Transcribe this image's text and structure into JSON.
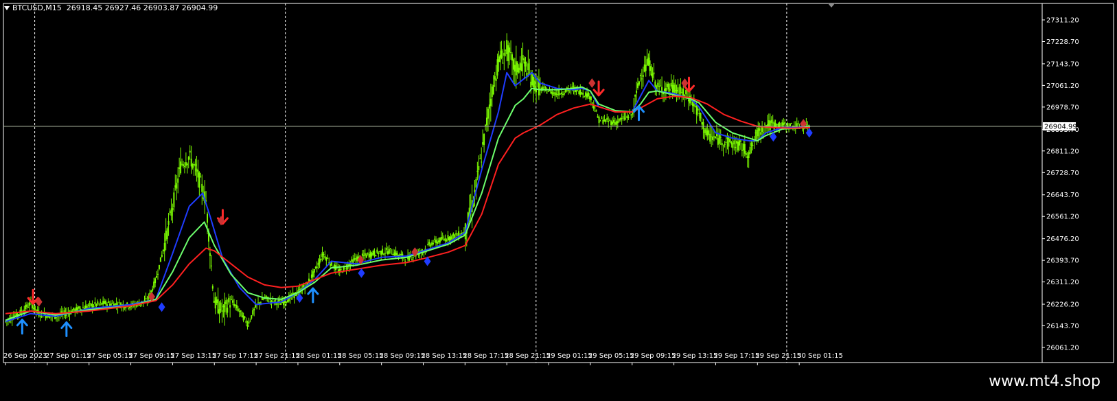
{
  "header": {
    "symbol": "BTCUSD,M15",
    "ohlc": "26918.45 26927.46 26903.87 26904.99"
  },
  "watermark": "www.mt4.shop",
  "colors": {
    "background": "#000000",
    "frame": "#ffffff",
    "candle": "#7CFC00",
    "ma_blue": "#1f3cff",
    "ma_green": "#6dff6d",
    "ma_red": "#ff2020",
    "arrow_up": "#1e90ff",
    "arrow_down": "#ff2a2a",
    "diamond_red": "#cc3333",
    "diamond_blue": "#1f3cff",
    "current_price_line": "#a9b29d"
  },
  "chart_data": {
    "type": "candlestick",
    "current_price": 26904.99,
    "current_price_label": "26904.99",
    "y_range": [
      26040,
      27340
    ],
    "x_range": [
      0,
      100
    ],
    "y_ticks": [
      {
        "value": 27311.2,
        "label": "27311.20"
      },
      {
        "value": 27228.7,
        "label": "27228.70"
      },
      {
        "value": 27143.7,
        "label": "27143.70"
      },
      {
        "value": 27061.2,
        "label": "27061.20"
      },
      {
        "value": 26978.7,
        "label": "26978.70"
      },
      {
        "value": 26893.7,
        "label": "26893.70"
      },
      {
        "value": 26811.2,
        "label": "26811.20"
      },
      {
        "value": 26728.7,
        "label": "26728.70"
      },
      {
        "value": 26643.7,
        "label": "26643.70"
      },
      {
        "value": 26561.2,
        "label": "26561.20"
      },
      {
        "value": 26476.2,
        "label": "26476.20"
      },
      {
        "value": 26393.7,
        "label": "26393.70"
      },
      {
        "value": 26311.2,
        "label": "26311.20"
      },
      {
        "value": 26226.2,
        "label": "26226.20"
      },
      {
        "value": 26143.7,
        "label": "26143.70"
      },
      {
        "value": 26061.2,
        "label": "26061.20"
      }
    ],
    "x_ticks": [
      {
        "x": 0,
        "label": "26 Sep 2023"
      },
      {
        "x": 5,
        "label": "27 Sep 01:15"
      },
      {
        "x": 10,
        "label": "27 Sep 05:15"
      },
      {
        "x": 15,
        "label": "27 Sep 09:15"
      },
      {
        "x": 20,
        "label": "27 Sep 13:15"
      },
      {
        "x": 25,
        "label": "27 Sep 17:15"
      },
      {
        "x": 30,
        "label": "27 Sep 21:15"
      },
      {
        "x": 35,
        "label": "28 Sep 01:15"
      },
      {
        "x": 40,
        "label": "28 Sep 05:15"
      },
      {
        "x": 45,
        "label": "28 Sep 09:15"
      },
      {
        "x": 50,
        "label": "28 Sep 13:15"
      },
      {
        "x": 55,
        "label": "28 Sep 17:15"
      },
      {
        "x": 60,
        "label": "28 Sep 21:15"
      },
      {
        "x": 65,
        "label": "29 Sep 01:15"
      },
      {
        "x": 70,
        "label": "29 Sep 05:15"
      },
      {
        "x": 75,
        "label": "29 Sep 09:15"
      },
      {
        "x": 80,
        "label": "29 Sep 13:15"
      },
      {
        "x": 85,
        "label": "29 Sep 17:15"
      },
      {
        "x": 90,
        "label": "29 Sep 21:15"
      },
      {
        "x": 95,
        "label": "30 Sep 01:15"
      }
    ],
    "day_separators": [
      3.5,
      33.5,
      63.5,
      93.5
    ],
    "price_anchors": [
      [
        0,
        26160
      ],
      [
        2,
        26200
      ],
      [
        3,
        26230
      ],
      [
        4,
        26190
      ],
      [
        6,
        26180
      ],
      [
        8,
        26200
      ],
      [
        10,
        26220
      ],
      [
        12,
        26230
      ],
      [
        15,
        26220
      ],
      [
        17,
        26240
      ],
      [
        18,
        26320
      ],
      [
        19,
        26450
      ],
      [
        20,
        26600
      ],
      [
        21,
        26760
      ],
      [
        22,
        26790
      ],
      [
        23,
        26720
      ],
      [
        24,
        26620
      ],
      [
        25,
        26230
      ],
      [
        26,
        26200
      ],
      [
        27,
        26240
      ],
      [
        28,
        26200
      ],
      [
        29,
        26150
      ],
      [
        30,
        26220
      ],
      [
        31,
        26250
      ],
      [
        32,
        26240
      ],
      [
        33,
        26230
      ],
      [
        34,
        26250
      ],
      [
        35,
        26270
      ],
      [
        36,
        26300
      ],
      [
        37,
        26350
      ],
      [
        38,
        26420
      ],
      [
        39,
        26380
      ],
      [
        40,
        26350
      ],
      [
        42,
        26400
      ],
      [
        44,
        26420
      ],
      [
        46,
        26430
      ],
      [
        48,
        26400
      ],
      [
        50,
        26430
      ],
      [
        51,
        26460
      ],
      [
        53,
        26480
      ],
      [
        55,
        26500
      ],
      [
        56,
        26620
      ],
      [
        57,
        26800
      ],
      [
        58,
        27000
      ],
      [
        59,
        27150
      ],
      [
        60,
        27200
      ],
      [
        61,
        27120
      ],
      [
        62,
        27150
      ],
      [
        63,
        27080
      ],
      [
        64,
        27050
      ],
      [
        66,
        27030
      ],
      [
        68,
        27050
      ],
      [
        70,
        27020
      ],
      [
        71,
        26930
      ],
      [
        73,
        26920
      ],
      [
        75,
        26950
      ],
      [
        76,
        27100
      ],
      [
        77,
        27150
      ],
      [
        78,
        27050
      ],
      [
        80,
        27050
      ],
      [
        82,
        27010
      ],
      [
        83,
        26950
      ],
      [
        84,
        26870
      ],
      [
        86,
        26850
      ],
      [
        88,
        26830
      ],
      [
        89,
        26800
      ],
      [
        90,
        26880
      ],
      [
        91,
        26910
      ],
      [
        93,
        26910
      ],
      [
        95,
        26905
      ],
      [
        96.3,
        26905
      ]
    ],
    "series": [
      {
        "name": "",
        "color_key": "ma_blue",
        "values": [
          [
            0,
            26160
          ],
          [
            3,
            26190
          ],
          [
            6,
            26180
          ],
          [
            10,
            26210
          ],
          [
            15,
            26225
          ],
          [
            18,
            26245
          ],
          [
            20,
            26420
          ],
          [
            22,
            26600
          ],
          [
            23.6,
            26650
          ],
          [
            24.5,
            26560
          ],
          [
            26,
            26400
          ],
          [
            28,
            26290
          ],
          [
            30,
            26225
          ],
          [
            33,
            26235
          ],
          [
            35,
            26270
          ],
          [
            37,
            26320
          ],
          [
            39,
            26390
          ],
          [
            42,
            26380
          ],
          [
            45,
            26405
          ],
          [
            48,
            26410
          ],
          [
            50,
            26430
          ],
          [
            53,
            26460
          ],
          [
            55,
            26500
          ],
          [
            57,
            26740
          ],
          [
            59,
            26960
          ],
          [
            60,
            27110
          ],
          [
            61,
            27060
          ],
          [
            62,
            27085
          ],
          [
            63,
            27110
          ],
          [
            64,
            27070
          ],
          [
            66,
            27050
          ],
          [
            68,
            27045
          ],
          [
            69,
            27050
          ],
          [
            70,
            27040
          ],
          [
            71,
            26980
          ],
          [
            73,
            26960
          ],
          [
            75,
            26960
          ],
          [
            76,
            27020
          ],
          [
            77,
            27080
          ],
          [
            78,
            27040
          ],
          [
            80,
            27030
          ],
          [
            82,
            27010
          ],
          [
            83,
            26980
          ],
          [
            85,
            26880
          ],
          [
            87,
            26860
          ],
          [
            89,
            26850
          ],
          [
            90,
            26850
          ],
          [
            91,
            26880
          ],
          [
            93,
            26900
          ],
          [
            95,
            26900
          ],
          [
            96.3,
            26905
          ]
        ]
      },
      {
        "name": "",
        "color_key": "ma_green",
        "values": [
          [
            0,
            26165
          ],
          [
            3,
            26200
          ],
          [
            6,
            26185
          ],
          [
            10,
            26205
          ],
          [
            15,
            26220
          ],
          [
            18,
            26245
          ],
          [
            20,
            26350
          ],
          [
            22,
            26480
          ],
          [
            23.8,
            26540
          ],
          [
            25,
            26450
          ],
          [
            27,
            26340
          ],
          [
            29,
            26270
          ],
          [
            31,
            26250
          ],
          [
            33,
            26245
          ],
          [
            35,
            26270
          ],
          [
            37,
            26310
          ],
          [
            39,
            26365
          ],
          [
            42,
            26375
          ],
          [
            45,
            26395
          ],
          [
            48,
            26405
          ],
          [
            50,
            26425
          ],
          [
            53,
            26455
          ],
          [
            55,
            26490
          ],
          [
            57,
            26650
          ],
          [
            59,
            26860
          ],
          [
            61,
            26985
          ],
          [
            62,
            27010
          ],
          [
            63,
            27050
          ],
          [
            64,
            27045
          ],
          [
            66,
            27045
          ],
          [
            68,
            27050
          ],
          [
            69,
            27055
          ],
          [
            70,
            27040
          ],
          [
            71,
            26990
          ],
          [
            73,
            26965
          ],
          [
            75,
            26960
          ],
          [
            76,
            26990
          ],
          [
            77,
            27035
          ],
          [
            78,
            27040
          ],
          [
            80,
            27025
          ],
          [
            82,
            27010
          ],
          [
            83,
            26995
          ],
          [
            85,
            26920
          ],
          [
            87,
            26880
          ],
          [
            89,
            26860
          ],
          [
            90,
            26850
          ],
          [
            91,
            26870
          ],
          [
            93,
            26895
          ],
          [
            95,
            26898
          ],
          [
            96.3,
            26905
          ]
        ]
      },
      {
        "name": "",
        "color_key": "ma_red",
        "values": [
          [
            0,
            26190
          ],
          [
            3,
            26200
          ],
          [
            6,
            26190
          ],
          [
            10,
            26200
          ],
          [
            15,
            26220
          ],
          [
            18,
            26240
          ],
          [
            20,
            26300
          ],
          [
            22,
            26380
          ],
          [
            24,
            26440
          ],
          [
            25,
            26430
          ],
          [
            27,
            26380
          ],
          [
            29,
            26330
          ],
          [
            31,
            26300
          ],
          [
            33,
            26290
          ],
          [
            35,
            26295
          ],
          [
            37,
            26320
          ],
          [
            39,
            26345
          ],
          [
            42,
            26360
          ],
          [
            45,
            26375
          ],
          [
            48,
            26385
          ],
          [
            50,
            26400
          ],
          [
            53,
            26425
          ],
          [
            55,
            26450
          ],
          [
            57,
            26570
          ],
          [
            59,
            26760
          ],
          [
            61,
            26860
          ],
          [
            62,
            26880
          ],
          [
            64,
            26910
          ],
          [
            66,
            26950
          ],
          [
            68,
            26975
          ],
          [
            70,
            26990
          ],
          [
            71,
            26980
          ],
          [
            73,
            26960
          ],
          [
            75,
            26960
          ],
          [
            76,
            26975
          ],
          [
            78,
            27010
          ],
          [
            80,
            27020
          ],
          [
            82,
            27015
          ],
          [
            84,
            26990
          ],
          [
            86,
            26950
          ],
          [
            88,
            26925
          ],
          [
            90,
            26905
          ],
          [
            92,
            26900
          ],
          [
            94,
            26898
          ],
          [
            96.3,
            26900
          ]
        ]
      }
    ],
    "markers": [
      {
        "type": "arrow-down",
        "x": 3.3,
        "y": 26265
      },
      {
        "type": "diamond-red",
        "x": 4.0,
        "y": 26235
      },
      {
        "type": "arrow-up",
        "x": 2.0,
        "y": 26130
      },
      {
        "type": "arrow-up",
        "x": 7.3,
        "y": 26120
      },
      {
        "type": "diamond-red",
        "x": 17.5,
        "y": 26255
      },
      {
        "type": "diamond-blue",
        "x": 18.7,
        "y": 26215
      },
      {
        "type": "arrow-down",
        "x": 26.0,
        "y": 26570
      },
      {
        "type": "diamond-red",
        "x": 25.8,
        "y": 26545
      },
      {
        "type": "diamond-blue",
        "x": 35.2,
        "y": 26250
      },
      {
        "type": "arrow-up",
        "x": 36.8,
        "y": 26250
      },
      {
        "type": "diamond-red",
        "x": 42.5,
        "y": 26395
      },
      {
        "type": "diamond-blue",
        "x": 42.6,
        "y": 26345
      },
      {
        "type": "diamond-red",
        "x": 49.0,
        "y": 26425
      },
      {
        "type": "diamond-blue",
        "x": 50.5,
        "y": 26390
      },
      {
        "type": "diamond-red",
        "x": 70.2,
        "y": 27070
      },
      {
        "type": "arrow-down",
        "x": 71.0,
        "y": 27060
      },
      {
        "type": "arrow-up",
        "x": 75.8,
        "y": 26945
      },
      {
        "type": "arrow-down",
        "x": 81.8,
        "y": 27075
      },
      {
        "type": "diamond-red",
        "x": 81.3,
        "y": 27070
      },
      {
        "type": "diamond-blue",
        "x": 91.9,
        "y": 26865
      },
      {
        "type": "diamond-red",
        "x": 95.5,
        "y": 26915
      },
      {
        "type": "diamond-blue",
        "x": 96.2,
        "y": 26880
      }
    ]
  }
}
